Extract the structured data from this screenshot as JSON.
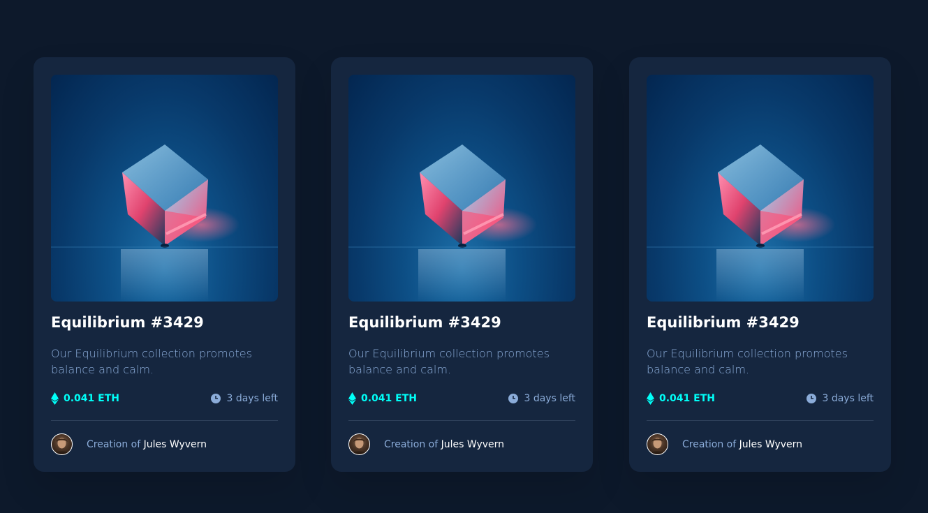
{
  "cards": [
    {
      "title": "Equilibrium #3429",
      "description": "Our Equilibrium collection promotes balance and calm.",
      "price": "0.041 ETH",
      "time_left": "3 days left",
      "creation_prefix": "Creation of",
      "creator": "Jules Wyvern"
    },
    {
      "title": "Equilibrium #3429",
      "description": "Our Equilibrium collection promotes balance and calm.",
      "price": "0.041 ETH",
      "time_left": "3 days left",
      "creation_prefix": "Creation of",
      "creator": "Jules Wyvern"
    },
    {
      "title": "Equilibrium #3429",
      "description": "Our Equilibrium collection promotes balance and calm.",
      "price": "0.041 ETH",
      "time_left": "3 days left",
      "creation_prefix": "Creation of",
      "creator": "Jules Wyvern"
    }
  ],
  "colors": {
    "background": "#0d192b",
    "card": "#15263f",
    "accent_cyan": "#00fff8",
    "soft_blue": "#8bacd9",
    "white": "#ffffff"
  },
  "icons": {
    "price": "ethereum-icon",
    "time": "clock-icon"
  }
}
